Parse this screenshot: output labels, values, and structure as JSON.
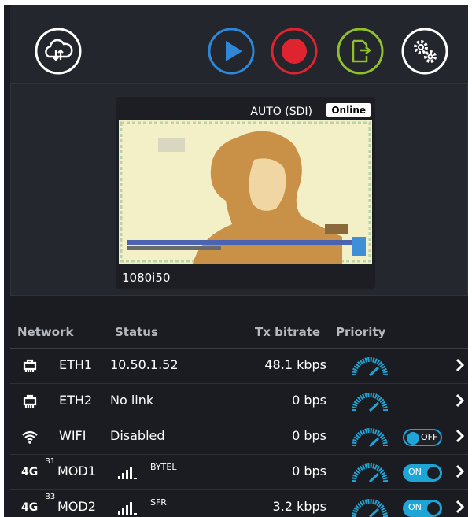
{
  "toolbar": {
    "buttons": [
      {
        "name": "cloud-sync",
        "color": "#ffffff"
      },
      {
        "name": "play",
        "color": "#2f87d8"
      },
      {
        "name": "record",
        "color": "#e0242f"
      },
      {
        "name": "export",
        "color": "#8fbf2b"
      },
      {
        "name": "settings",
        "color": "#ffffff"
      }
    ]
  },
  "preview": {
    "source": "AUTO (SDI)",
    "status": "Online",
    "resolution": "1080i50"
  },
  "table": {
    "headers": {
      "network": "Network",
      "status": "Status",
      "tx": "Tx bitrate",
      "priority": "Priority"
    },
    "rows": [
      {
        "iface": "ETH1",
        "status": "10.50.1.52",
        "tx": "48.1 kbps",
        "icon": "ethernet-icon"
      },
      {
        "iface": "ETH2",
        "status": "No link",
        "tx": "0 bps",
        "icon": "ethernet-icon"
      },
      {
        "iface": "WIFI",
        "status": "Disabled",
        "tx": "0 bps",
        "icon": "wifi-icon",
        "toggle": "OFF"
      },
      {
        "iface": "MOD1",
        "tag": "4G",
        "band": "B1",
        "carrier": "BYTEL",
        "tx": "0 bps",
        "toggle": "ON"
      },
      {
        "iface": "MOD2",
        "tag": "4G",
        "band": "B3",
        "carrier": "SFR",
        "tx": "3.2 kbps",
        "toggle": "ON"
      }
    ]
  },
  "colors": {
    "accent": "#1fa4d6",
    "background": "#1a1c21"
  }
}
